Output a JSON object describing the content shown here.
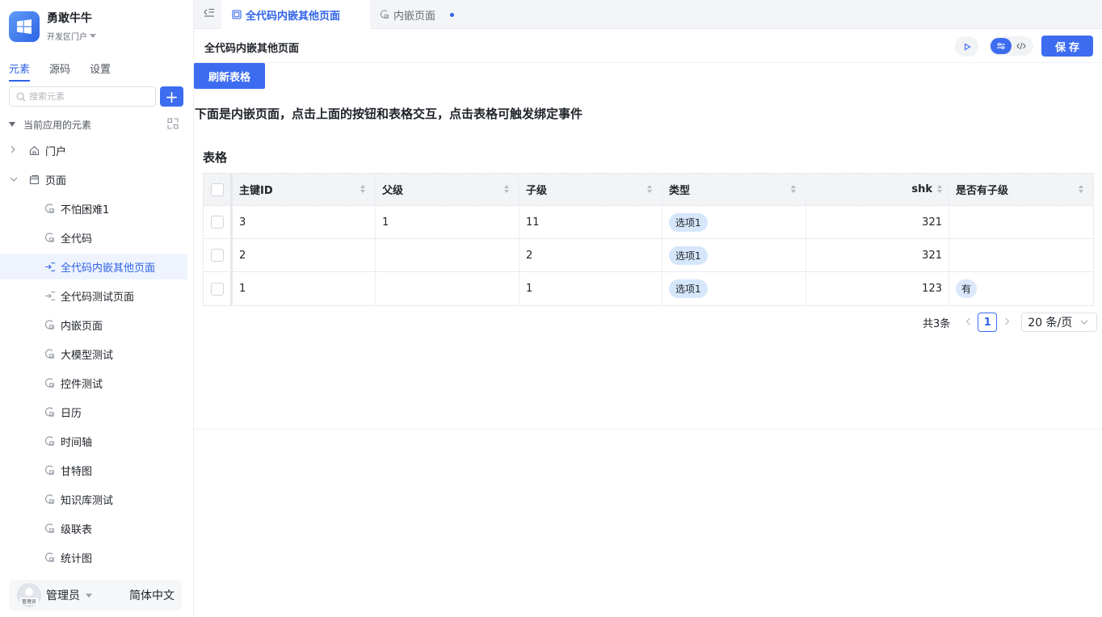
{
  "app": {
    "name": "勇敢牛牛",
    "portal": "开发区门户"
  },
  "sidebar": {
    "tabs": [
      {
        "label": "元素",
        "active": true
      },
      {
        "label": "源码",
        "active": false
      },
      {
        "label": "设置",
        "active": false
      }
    ],
    "search_placeholder": "搜索元素",
    "add_label": "+",
    "section_title": "当前应用的元素",
    "groups": [
      {
        "label": "门户",
        "expanded": false
      },
      {
        "label": "页面",
        "expanded": true
      }
    ],
    "pages": [
      {
        "label": "不怕困难1",
        "icon": "page-icon"
      },
      {
        "label": "全代码",
        "icon": "page-icon"
      },
      {
        "label": "全代码内嵌其他页面",
        "icon": "embed-icon",
        "selected": true
      },
      {
        "label": "全代码测试页面",
        "icon": "embed-icon"
      },
      {
        "label": "内嵌页面",
        "icon": "page-icon"
      },
      {
        "label": "大模型测试",
        "icon": "page-icon"
      },
      {
        "label": "控件测试",
        "icon": "page-icon"
      },
      {
        "label": "日历",
        "icon": "page-icon"
      },
      {
        "label": "时间轴",
        "icon": "page-icon"
      },
      {
        "label": "甘特图",
        "icon": "page-icon"
      },
      {
        "label": "知识库测试",
        "icon": "page-icon"
      },
      {
        "label": "级联表",
        "icon": "page-icon"
      },
      {
        "label": "统计图",
        "icon": "page-icon"
      }
    ],
    "user": {
      "avatar_tag": "管理员",
      "name": "管理员",
      "language": "简体中文"
    }
  },
  "tabs": [
    {
      "label": "全代码内嵌其他页面",
      "active": true
    },
    {
      "label": "内嵌页面",
      "active": false,
      "unsaved": true
    }
  ],
  "header": {
    "title": "全代码内嵌其他页面",
    "save_label": "保存"
  },
  "canvas": {
    "refresh_label": "刷新表格",
    "description": "下面是内嵌页面，点击上面的按钮和表格交互，点击表格可触发绑定事件",
    "table_title": "表格",
    "columns": [
      "主键ID",
      "父级",
      "子级",
      "类型",
      "shk",
      "是否有子级"
    ],
    "rows": [
      {
        "id": "3",
        "parent": "1",
        "child": "11",
        "type": "选项1",
        "shk": "321",
        "has_children": ""
      },
      {
        "id": "2",
        "parent": "",
        "child": "2",
        "type": "选项1",
        "shk": "321",
        "has_children": ""
      },
      {
        "id": "1",
        "parent": "",
        "child": "1",
        "type": "选项1",
        "shk": "123",
        "has_children": "有"
      }
    ],
    "pagination": {
      "total": "共3条",
      "current_page": "1",
      "page_size": "20 条/页"
    }
  },
  "colors": {
    "accent": "#3d6cf0",
    "accent_text": "#2f63e6",
    "selected_bg": "#eef3fe",
    "tag_bg": "#d6e6fb"
  }
}
